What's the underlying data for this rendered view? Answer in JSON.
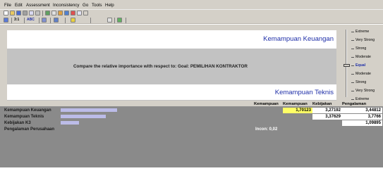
{
  "menu": {
    "items": [
      "File",
      "Edit",
      "Assessment",
      "Inconsistency",
      "Go",
      "Tools",
      "Help"
    ]
  },
  "toolbar": {
    "icons": [
      "new-icon",
      "open-icon",
      "save-icon",
      "print-icon",
      "undo-icon",
      "cut-icon",
      "copy-icon",
      "paste-icon",
      "tree-icon",
      "chart-icon",
      "graph-icon",
      "report-icon",
      "wizard-icon"
    ],
    "mode_labels": [
      "3:1",
      "ABC"
    ]
  },
  "comparison": {
    "top_criterion": "Kemampuan Keuangan",
    "prompt": "Compare the relative importance with respect to: Goal: PEMILIHAN KONTRAKTOR",
    "bottom_criterion": "Kemampuan Teknis"
  },
  "scale": {
    "labels": [
      "Extreme",
      "Very Strong",
      "Strong",
      "Moderate",
      "Equal",
      "Moderate",
      "Strong",
      "Very Strong",
      "Extreme"
    ],
    "selected_index": 4
  },
  "matrix": {
    "columns": [
      "Kemampuan",
      "Kemampuan",
      "Kebijakan",
      "Pengalaman"
    ],
    "rows": [
      {
        "label": "Kemampuan Keuangan",
        "values": [
          "",
          "1,70123",
          "3,27192",
          "3,44812"
        ],
        "bar_fraction": 1.0
      },
      {
        "label": "Kemampuan Teknis",
        "values": [
          "",
          "",
          "3,37629",
          "3,7766"
        ],
        "bar_fraction": 0.8
      },
      {
        "label": "Kebijakan K3",
        "values": [
          "",
          "",
          "",
          "1,09895"
        ],
        "bar_fraction": 0.32
      },
      {
        "label": "Pengalaman Perusahaan",
        "values": [
          "",
          "",
          "",
          ""
        ],
        "bar_fraction": 0.0
      }
    ],
    "inconsistency": "Incon: 0,02",
    "highlight_color": "#ffff66",
    "bar_color": "#bcbce8",
    "criterion_text_color": "#1f2fa8"
  }
}
